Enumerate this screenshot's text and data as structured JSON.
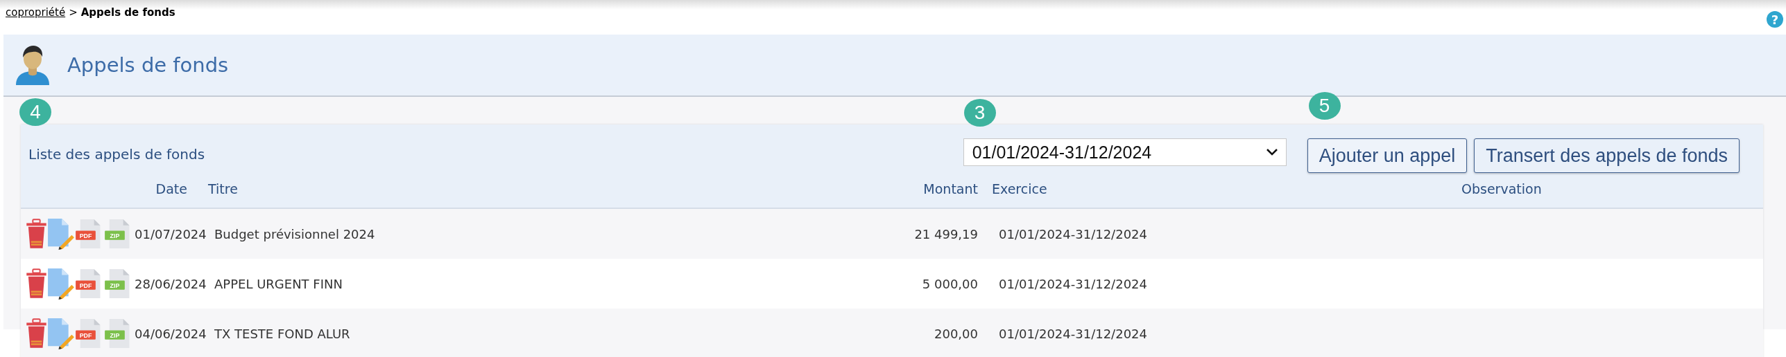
{
  "breadcrumb": {
    "link": "copropriété",
    "separator": ">",
    "current": "Appels de fonds"
  },
  "help": {
    "label": "?"
  },
  "header": {
    "title": "Appels de fonds"
  },
  "markers": [
    {
      "label": "4",
      "kind": "panel"
    },
    {
      "label": "3",
      "kind": "period"
    },
    {
      "label": "5",
      "kind": "add"
    }
  ],
  "panel": {
    "title": "Liste des appels de fonds",
    "period_select": {
      "value": "01/01/2024-31/12/2024"
    },
    "buttons": [
      {
        "kind": "add",
        "label": "Ajouter un appel"
      },
      {
        "kind": "transfer",
        "label": "Transert des appels de fonds"
      }
    ],
    "columns": [
      "Date",
      "Titre",
      "Montant",
      "Exercice",
      "Observation"
    ],
    "rows": [
      {
        "date": "01/07/2024",
        "title": "Budget prévisionnel 2024",
        "amount": "21 499,19",
        "period": "01/01/2024-31/12/2024",
        "pdf_label": "PDF",
        "zip_label": "ZIP"
      },
      {
        "date": "28/06/2024",
        "title": "APPEL URGENT FINN",
        "amount": "5 000,00",
        "period": "01/01/2024-31/12/2024",
        "pdf_label": "PDF",
        "zip_label": "ZIP"
      },
      {
        "date": "04/06/2024",
        "title": "TX TESTE FOND ALUR",
        "amount": "200,00",
        "period": "01/01/2024-31/12/2024",
        "pdf_label": "PDF",
        "zip_label": "ZIP"
      }
    ]
  }
}
